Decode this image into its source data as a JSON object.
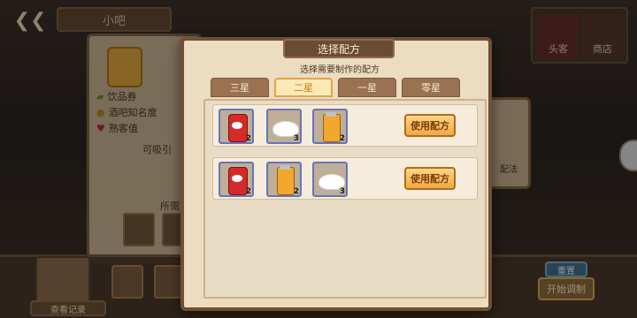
{
  "background": {
    "bar_title": "小吧",
    "right_buttons": [
      "头客",
      "商店"
    ],
    "left_panel": {
      "rows": [
        {
          "icon": "ticket-icon",
          "label": "饮品券"
        },
        {
          "icon": "coin-icon",
          "label": "酒吧知名度"
        },
        {
          "icon": "heart-icon",
          "label": "熟客值"
        }
      ],
      "attract_label": "可吸引",
      "ingredients_label": "所需"
    },
    "right_panel_label": "配法",
    "bottom": {
      "record_label": "查看记录",
      "reset_label": "重置",
      "start_label": "开始调制"
    }
  },
  "dialog": {
    "title": "选择配方",
    "subtitle": "选择需要制作的配方",
    "tabs": [
      {
        "label": "三星",
        "active": false
      },
      {
        "label": "二星",
        "active": true
      },
      {
        "label": "一星",
        "active": false
      },
      {
        "label": "零星",
        "active": false
      }
    ],
    "recipes": [
      {
        "ingredients": [
          {
            "name": "soda-can",
            "qty": "2"
          },
          {
            "name": "sugar-powder",
            "qty": "3"
          },
          {
            "name": "orange-juice",
            "qty": "2"
          }
        ],
        "button_label": "使用配方"
      },
      {
        "ingredients": [
          {
            "name": "soda-can",
            "qty": "2"
          },
          {
            "name": "orange-juice",
            "qty": "2"
          },
          {
            "name": "sugar-powder",
            "qty": "3"
          }
        ],
        "button_label": "使用配方"
      }
    ]
  },
  "colors": {
    "active_tab_text": "#d07a1a",
    "use_button": "#f0a846",
    "dialog_frame": "#6f4f35"
  }
}
